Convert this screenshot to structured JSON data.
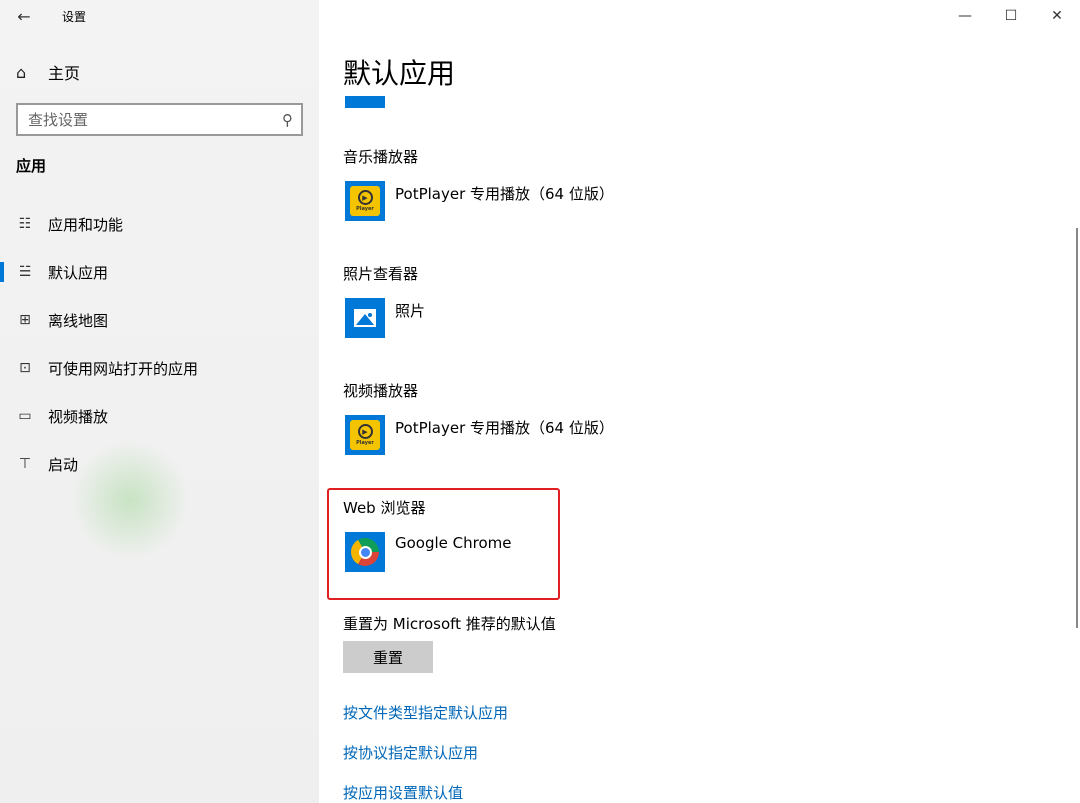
{
  "window": {
    "title": "设置",
    "back_glyph": "←",
    "minimize_glyph": "—",
    "maximize_glyph": "☐",
    "close_glyph": "✕"
  },
  "sidebar": {
    "home_label": "主页",
    "search_placeholder": "查找设置",
    "section_title": "应用",
    "items": [
      {
        "label": "应用和功能",
        "icon": "apps-list-icon",
        "glyph": "☷",
        "active": false
      },
      {
        "label": "默认应用",
        "icon": "default-apps-icon",
        "glyph": "☱",
        "active": true
      },
      {
        "label": "离线地图",
        "icon": "offline-map-icon",
        "glyph": "⊞",
        "active": false
      },
      {
        "label": "可使用网站打开的应用",
        "icon": "open-with-website-icon",
        "glyph": "⊡",
        "active": false
      },
      {
        "label": "视频播放",
        "icon": "video-playback-icon",
        "glyph": "▭",
        "active": false
      },
      {
        "label": "启动",
        "icon": "startup-icon",
        "glyph": "⊤",
        "active": false
      }
    ]
  },
  "main": {
    "page_title": "默认应用",
    "groups": [
      {
        "label": "音乐播放器",
        "app": "PotPlayer 专用播放（64 位版）",
        "icon": "potplayer-icon"
      },
      {
        "label": "照片查看器",
        "app": "照片",
        "icon": "photos-icon"
      },
      {
        "label": "视频播放器",
        "app": "PotPlayer 专用播放（64 位版）",
        "icon": "potplayer-icon"
      },
      {
        "label": "Web 浏览器",
        "app": "Google Chrome",
        "icon": "chrome-icon"
      }
    ],
    "potplayer_badge": "Player",
    "reset_label": "重置为 Microsoft 推荐的默认值",
    "reset_button": "重置",
    "links": [
      "按文件类型指定默认应用",
      "按协议指定默认应用",
      "按应用设置默认值"
    ]
  },
  "colors": {
    "accent": "#0078d7",
    "link": "#0067b8",
    "highlight": "#e02020",
    "sidebar_bg": "#f2f2f2"
  }
}
